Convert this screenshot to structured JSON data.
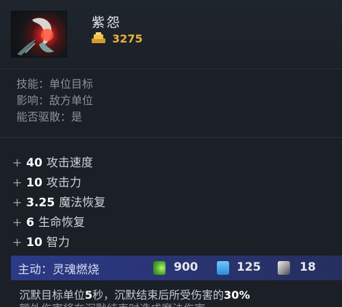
{
  "item": {
    "name": "紫怨",
    "cost": "3275",
    "icon": "orchid-malevolence-icon"
  },
  "info": {
    "skill": "技能：单位目标",
    "affects": "影响：敌方单位",
    "dispellable": "能否驱散：是"
  },
  "stats": [
    {
      "plus": "+",
      "value": "40",
      "label": "攻击速度"
    },
    {
      "plus": "+",
      "value": "10",
      "label": "攻击力"
    },
    {
      "plus": "+",
      "value": "3.25",
      "label": "魔法恢复"
    },
    {
      "plus": "+",
      "value": "6",
      "label": "生命恢复"
    },
    {
      "plus": "+",
      "value": "10",
      "label": "智力"
    }
  ],
  "active": {
    "label": "主动：灵魂燃烧",
    "cooldown": "900",
    "mana": "125",
    "health": "18",
    "cooldown_icon": "cooldown-icon",
    "mana_icon": "mana-icon",
    "health_icon": "health-cost-icon"
  },
  "description": {
    "part1": "沉默目标单位",
    "bold1": "5",
    "part2": "秒，沉默结束后所受伤害的",
    "bold2": "30%",
    "next_line": "额外伤害将在沉默结束时造成魔法伤害"
  },
  "colors": {
    "gold": "#e9b33c",
    "active_bar": "#2b3a86",
    "background": "#1b1f26"
  }
}
